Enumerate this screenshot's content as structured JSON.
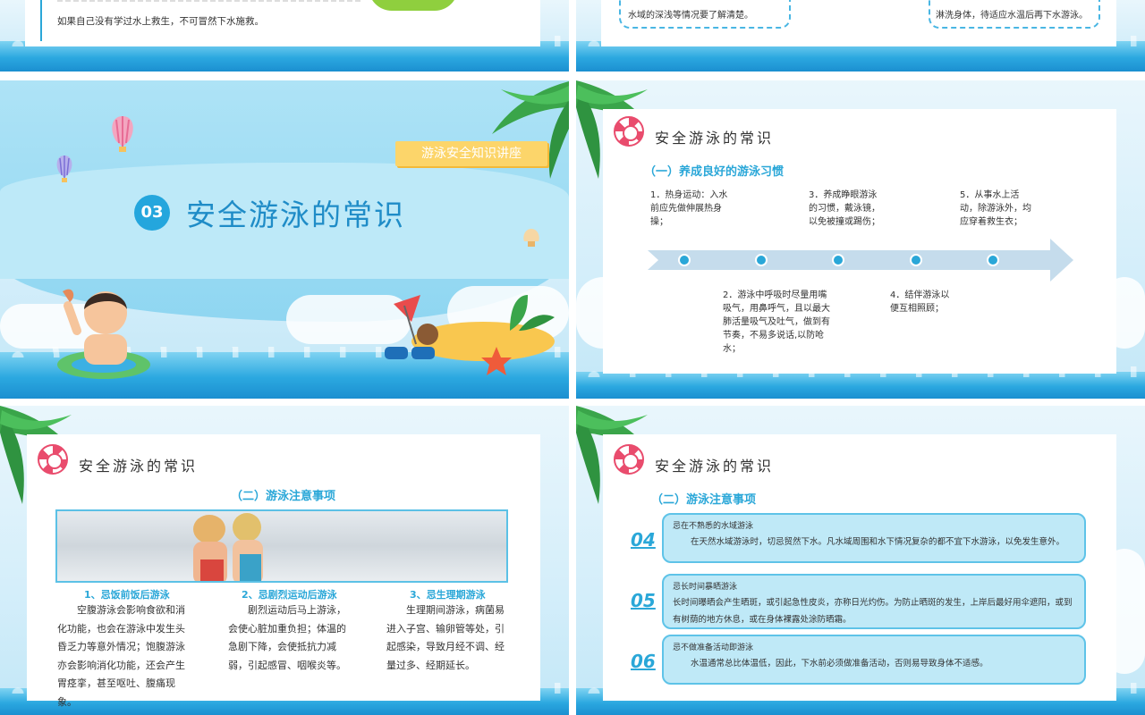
{
  "slide1": {
    "line1": "如果自己没有学过水上救生，不可冒然下水施救。"
  },
  "slide2": {
    "left_note": "水域的深浅等情况要了解清楚。",
    "right_note": "淋洗身体，待适应水温后再下水游泳。"
  },
  "slide3": {
    "badge": "游泳安全知识讲座",
    "number": "03",
    "title": "安全游泳的常识"
  },
  "slide4": {
    "title": "安全游泳的常识",
    "subtitle": "（一）养成良好的游泳习惯",
    "items": [
      {
        "text": "1．热身运动：入水前应先做伸展热身操；"
      },
      {
        "text": "2．游泳中呼吸时尽量用嘴吸气，用鼻呼气，且以最大肺活量吸气及吐气，做到有节奏，不易多说话,以防呛水；"
      },
      {
        "text": "3．养成睁眼游泳的习惯，戴泳镜，以免被撞或踢伤；"
      },
      {
        "text": "4．结伴游泳以便互相照顾；"
      },
      {
        "text": "5．从事水上活动，除游泳外，均应穿着救生衣；"
      }
    ]
  },
  "slide5": {
    "title": "安全游泳的常识",
    "subtitle": "（二）游泳注意事项",
    "columns": [
      {
        "heading": "1、忌饭前饭后游泳",
        "body": "空腹游泳会影响食欲和消化功能，也会在游泳中发生头昏乏力等意外情况；饱腹游泳亦会影响消化功能，还会产生胃痉挛，甚至呕吐、腹痛现象。"
      },
      {
        "heading": "2、忌剧烈运动后游泳",
        "body": "剧烈运动后马上游泳，会使心脏加重负担；体温的急剧下降，会使抵抗力减弱，引起感冒、咽喉炎等。"
      },
      {
        "heading": "3、忌生理期游泳",
        "body": "生理期间游泳，病菌易进入子宫、输卵管等处，引起感染，导致月经不调、经量过多、经期延长。"
      }
    ]
  },
  "slide6": {
    "title": "安全游泳的常识",
    "subtitle": "（二）游泳注意事项",
    "notes": [
      {
        "num": "04",
        "title": "忌在不熟悉的水域游泳",
        "body": "在天然水域游泳时，切忌贸然下水。凡水域周围和水下情况复杂的都不宜下水游泳，以免发生意外。"
      },
      {
        "num": "05",
        "title": "忌长时间暴晒游泳",
        "body": "长时间曝晒会产生晒斑，或引起急性皮炎，亦称日光灼伤。为防止晒斑的发生，上岸后最好用伞遮阳，或到有树荫的地方休息，或在身体裸露处涂防晒霜。"
      },
      {
        "num": "06",
        "title": "忌不做准备活动即游泳",
        "body": "水温通常总比体温低，因此，下水前必须做准备活动，否则易导致身体不适感。"
      }
    ]
  },
  "colors": {
    "accent": "#2aa7d8",
    "badge": "#fcd56a",
    "ring": "#e94c6d"
  }
}
